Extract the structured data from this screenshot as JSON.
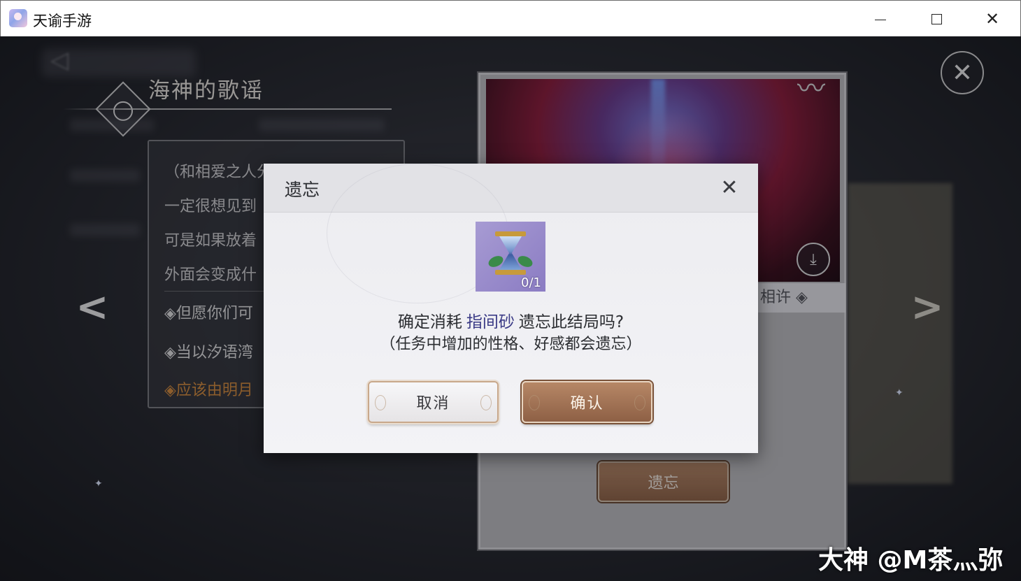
{
  "window": {
    "title": "天谕手游",
    "minimize": "—",
    "maximize": "☐",
    "close": "✕"
  },
  "game": {
    "chapter_title": "海神的歌谣",
    "dialogue_lines": [
      "（和相爱之人分别了，千年，她",
      "一定很想见到",
      "可是如果放着",
      "外面会变成什"
    ],
    "choices": [
      {
        "text": "◈但愿你们可",
        "active": false
      },
      {
        "text": "◈当以汐语湾",
        "active": false
      },
      {
        "text": "◈应该由明月",
        "active": true
      }
    ],
    "nav_left": "<",
    "nav_right": ">",
    "close_icon": "✕",
    "card_tag": "相许 ◈",
    "download_icon": "⤓",
    "forget_button": "遗忘"
  },
  "modal": {
    "title": "遗忘",
    "close_icon": "✕",
    "item_icon": "hourglass-icon",
    "item_count": "0/1",
    "confirm_prefix": "确定消耗",
    "item_name": "指间砂",
    "confirm_suffix": "遗忘此结局吗?",
    "sub_text": "（任务中增加的性格、好感都会遗忘）",
    "cancel_label": "取消",
    "ok_label": "确认"
  },
  "watermark": "大神 @M茶灬弥",
  "colors": {
    "accent_orange": "#d38b3d",
    "item_name": "#3b3b86",
    "button_brown": "#8e6045"
  }
}
